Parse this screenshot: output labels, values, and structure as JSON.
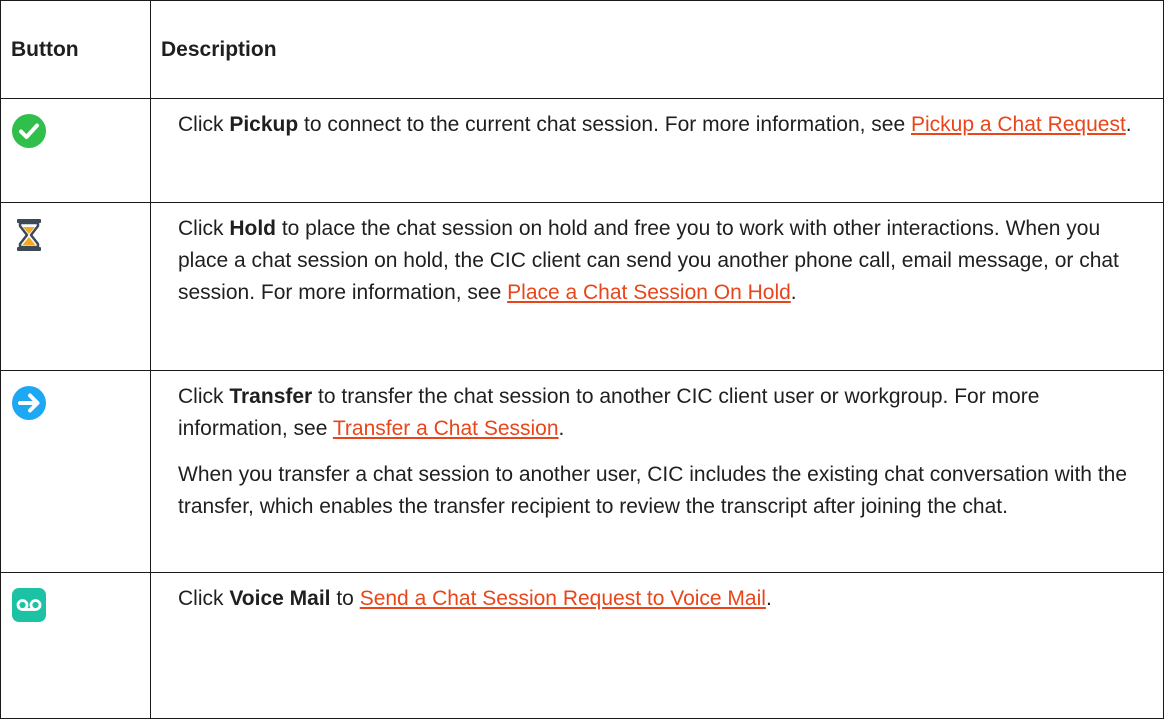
{
  "table": {
    "headers": {
      "button": "Button",
      "description": "Description"
    },
    "rows": [
      {
        "icon": "checkmark-circle-icon",
        "pre": "Click ",
        "bold": "Pickup",
        "post": " to connect to the current chat session. For more information, see ",
        "link": "Pickup a Chat Request",
        "end": "."
      },
      {
        "icon": "hourglass-icon",
        "pre": "Click ",
        "bold": "Hold",
        "post": " to place the chat session on hold and free you to work with other interactions. When you place a chat session on hold, the CIC client can send you another phone call, email message, or chat session. For more information, see ",
        "link": "Place a Chat Session On Hold",
        "end": "."
      },
      {
        "icon": "arrow-right-circle-icon",
        "pre": "Click ",
        "bold": "Transfer",
        "post": " to transfer the chat session to another CIC client user or workgroup. For more information, see ",
        "link": "Transfer a Chat Session",
        "end": ".",
        "extra": "When you transfer a chat session to another user, CIC includes the existing chat conversation with the transfer, which enables the transfer recipient to review the transcript after joining the chat."
      },
      {
        "icon": "voicemail-icon",
        "pre": "Click ",
        "bold": "Voice Mail",
        "post": " to ",
        "link": "Send a Chat Session Request to Voice Mail",
        "end": "."
      }
    ]
  },
  "colors": {
    "link": "#e8461a",
    "pickup": "#2fbf4a",
    "hold_frame": "#3d4a55",
    "hold_sand": "#f5a623",
    "transfer": "#1ea7f2",
    "voicemail": "#1cc2a4"
  }
}
